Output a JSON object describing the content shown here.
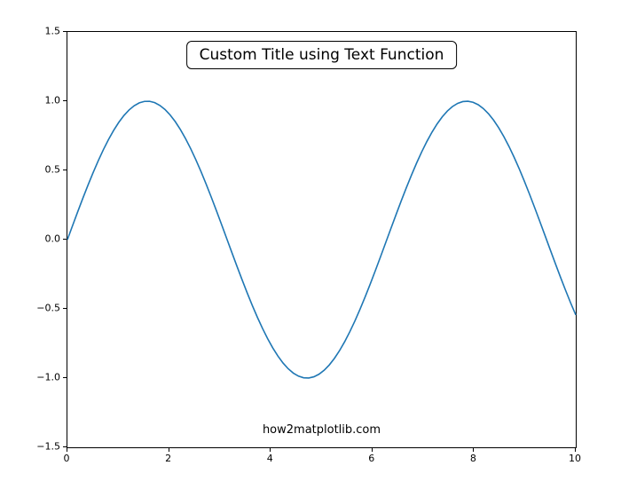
{
  "chart_data": {
    "type": "line",
    "title": "Custom Title using Text Function",
    "annotation": "how2matplotlib.com",
    "xlabel": "",
    "ylabel": "",
    "xlim": [
      0,
      10
    ],
    "ylim": [
      -1.5,
      1.5
    ],
    "xticks": [
      0,
      2,
      4,
      6,
      8,
      10
    ],
    "yticks": [
      -1.5,
      -1.0,
      -0.5,
      0.0,
      0.5,
      1.0,
      1.5
    ],
    "x": [
      0.0,
      0.101,
      0.202,
      0.303,
      0.404,
      0.505,
      0.606,
      0.707,
      0.808,
      0.909,
      1.01,
      1.111,
      1.212,
      1.313,
      1.414,
      1.515,
      1.616,
      1.717,
      1.818,
      1.919,
      2.02,
      2.121,
      2.222,
      2.323,
      2.424,
      2.525,
      2.626,
      2.727,
      2.828,
      2.929,
      3.03,
      3.131,
      3.232,
      3.333,
      3.434,
      3.535,
      3.636,
      3.737,
      3.838,
      3.939,
      4.04,
      4.141,
      4.242,
      4.343,
      4.444,
      4.545,
      4.646,
      4.747,
      4.848,
      4.949,
      5.051,
      5.152,
      5.253,
      5.354,
      5.455,
      5.556,
      5.657,
      5.758,
      5.859,
      5.96,
      6.061,
      6.162,
      6.263,
      6.364,
      6.465,
      6.566,
      6.667,
      6.768,
      6.869,
      6.97,
      7.071,
      7.172,
      7.273,
      7.374,
      7.475,
      7.576,
      7.677,
      7.778,
      7.879,
      7.98,
      8.081,
      8.182,
      8.283,
      8.384,
      8.485,
      8.586,
      8.687,
      8.788,
      8.889,
      8.99,
      9.091,
      9.192,
      9.293,
      9.394,
      9.495,
      9.596,
      9.697,
      9.798,
      9.899,
      10.0
    ],
    "y": [
      0.0,
      0.1008,
      0.2006,
      0.2984,
      0.3931,
      0.4839,
      0.5696,
      0.6496,
      0.7229,
      0.789,
      0.8469,
      0.8962,
      0.9364,
      0.967,
      0.9878,
      0.9985,
      0.9991,
      0.9895,
      0.9699,
      0.9405,
      0.9016,
      0.8536,
      0.7971,
      0.7326,
      0.6608,
      0.5824,
      0.4984,
      0.4095,
      0.3167,
      0.2208,
      0.1229,
      0.0239,
      -0.0752,
      -0.1734,
      -0.2697,
      -0.363,
      -0.4524,
      -0.537,
      -0.6159,
      -0.6882,
      -0.7533,
      -0.8104,
      -0.8589,
      -0.8983,
      -0.9282,
      -0.9482,
      -0.9582,
      -0.958,
      -0.9477,
      -0.9273,
      -0.897,
      -0.8572,
      -0.8081,
      -0.7503,
      -0.6844,
      -0.6111,
      -0.5311,
      -0.4454,
      -0.3549,
      -0.2607,
      -0.1636,
      -0.065,
      0.0341,
      0.1327,
      0.2297,
      0.324,
      0.4147,
      0.5006,
      0.5808,
      0.6545,
      0.7209,
      0.7791,
      0.8287,
      0.869,
      0.8997,
      0.9205,
      0.9312,
      0.9317,
      0.9219,
      0.9021,
      0.8725,
      0.8333,
      0.7852,
      0.7286,
      0.6641,
      0.5925,
      0.5146,
      0.4312,
      0.3433,
      0.2518,
      0.1578,
      0.0623,
      -0.0336,
      -0.1288,
      -0.2222,
      -0.3128,
      -0.3996,
      -0.4817,
      -0.5581,
      -0.544
    ]
  },
  "colors": {
    "line": "#1f77b4"
  }
}
